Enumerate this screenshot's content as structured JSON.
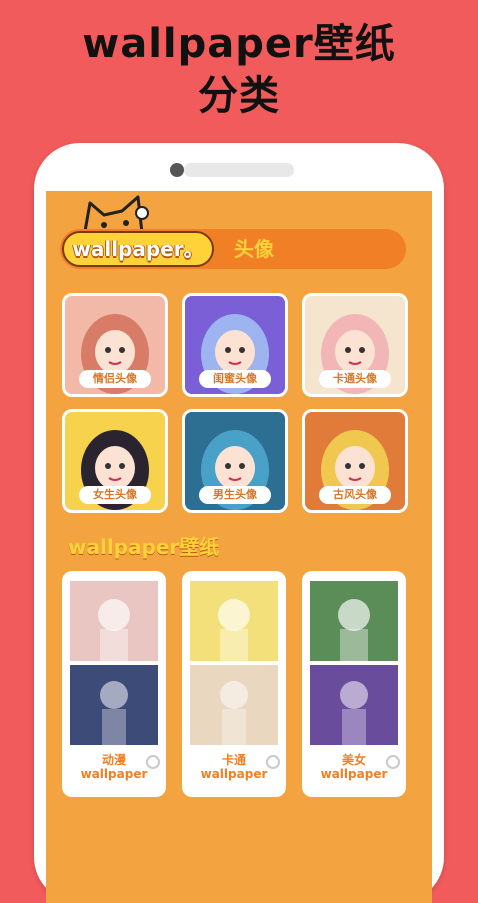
{
  "promo": {
    "title_line1": "wallpaper壁纸",
    "title_line2": "分类"
  },
  "header": {
    "brand": "wallpaper。",
    "tab": "头像"
  },
  "avatars": [
    {
      "label": "情侣头像",
      "bg": "#f2b9a8",
      "hair": "#d87c67"
    },
    {
      "label": "闺蜜头像",
      "bg": "#7a5fd6",
      "hair": "#9db4f0"
    },
    {
      "label": "卡通头像",
      "bg": "#f5e5cf",
      "hair": "#f3b6b6"
    },
    {
      "label": "女生头像",
      "bg": "#f7d24c",
      "hair": "#2a2430"
    },
    {
      "label": "男生头像",
      "bg": "#2d6f92",
      "hair": "#4aa1c8"
    },
    {
      "label": "古风头像",
      "bg": "#e07b3a",
      "hair": "#f0c850"
    }
  ],
  "section2": {
    "title": "wallpaper壁纸"
  },
  "cards": [
    {
      "title": "动漫",
      "sub": "wallpaper",
      "top_bg": "#e9c6c2",
      "bottom_bg": "#3c4b78"
    },
    {
      "title": "卡通",
      "sub": "wallpaper",
      "top_bg": "#f4e07a",
      "bottom_bg": "#e9d7bf"
    },
    {
      "title": "美女",
      "sub": "wallpaper",
      "top_bg": "#5a8d57",
      "bottom_bg": "#6a4c9c"
    }
  ]
}
